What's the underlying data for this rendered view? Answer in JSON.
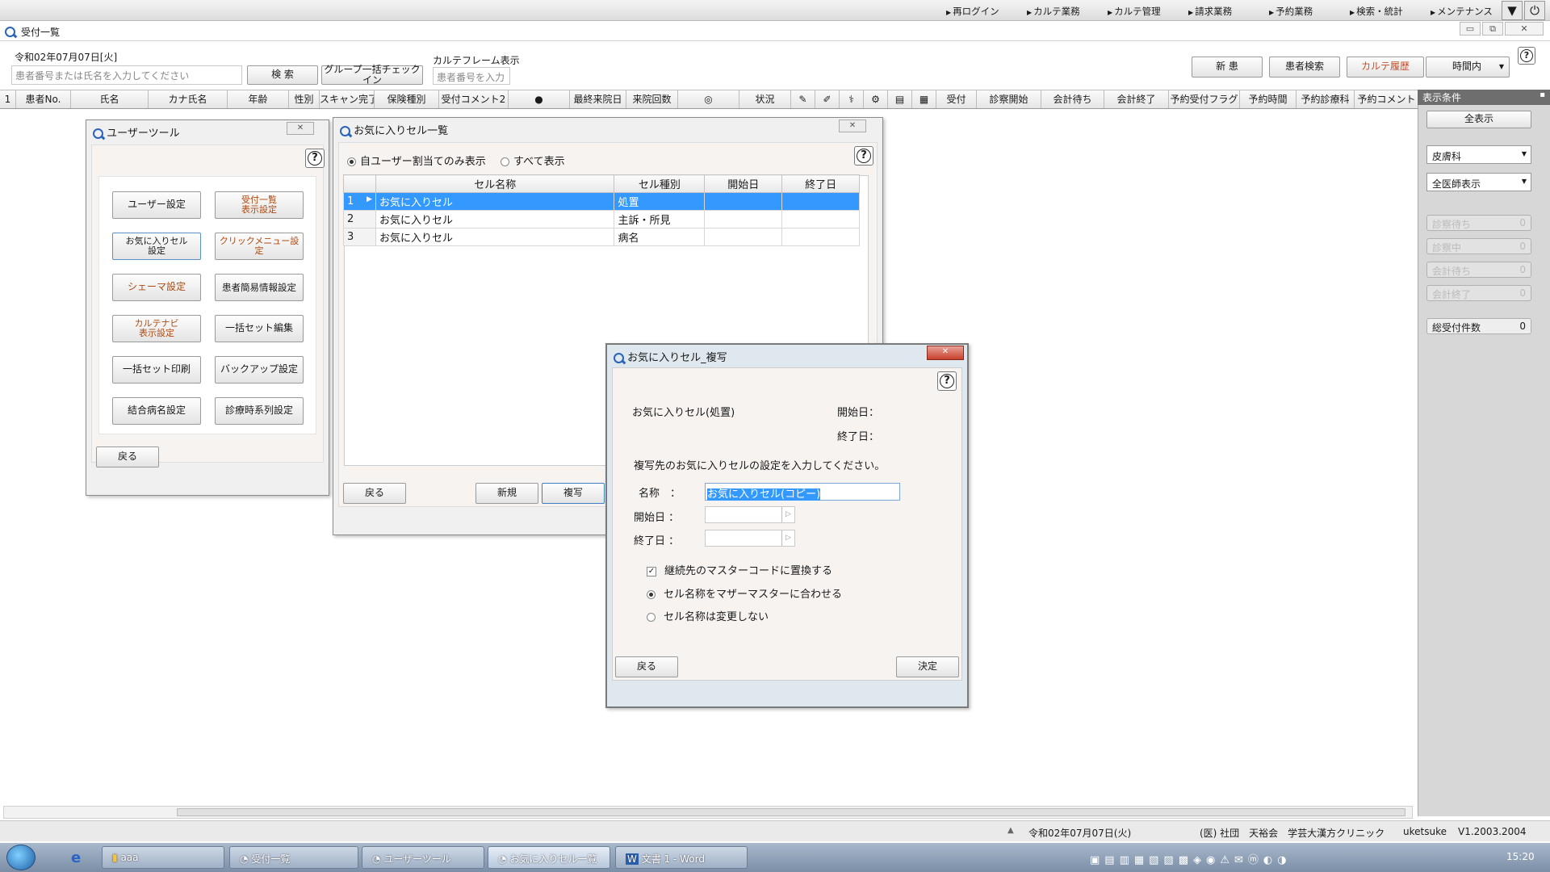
{
  "top_menu": {
    "items": [
      "再ログイン",
      "カルテ業務",
      "カルテ管理",
      "請求業務",
      "予約業務",
      "検索・統計",
      "メンテナンス"
    ]
  },
  "main_window": {
    "title": "受付一覧",
    "date_label": "令和02年07月07日[火]",
    "search_placeholder": "患者番号または氏名を入力してください",
    "search_button": "検 索",
    "group_checkin_button": "グループ一括チェックイン",
    "karte_frame_label": "カルテフレーム表示",
    "patient_number_placeholder": "患者番号を入力",
    "new_patient_button": "新 患",
    "patient_search_button": "患者検索",
    "karte_history_button": "カルテ履歴",
    "time_select": "時間内"
  },
  "columns": [
    "1",
    "患者No.",
    "氏名",
    "カナ氏名",
    "年齢",
    "性別",
    "スキャン完了",
    "保険種別",
    "受付コメント2",
    "",
    "最終来院日",
    "来院回数",
    "",
    "状況",
    "",
    "",
    "",
    "",
    "",
    "",
    "受付",
    "診察開始",
    "会計待ち",
    "会計終了",
    "予約受付フラグ",
    "予約時間",
    "予約診療科",
    "予約コメント"
  ],
  "right_panel": {
    "header": "表示条件",
    "all_button": "全表示",
    "dept_select": "皮膚科",
    "doctor_select": "全医師表示",
    "counters": [
      {
        "label": "診察待ち",
        "value": "0"
      },
      {
        "label": "診察中",
        "value": "0"
      },
      {
        "label": "会計待ち",
        "value": "0"
      },
      {
        "label": "会計終了",
        "value": "0"
      }
    ],
    "total": {
      "label": "総受付件数",
      "value": "0"
    }
  },
  "user_tool": {
    "title": "ユーザーツール",
    "buttons": [
      {
        "label": "ユーザー設定",
        "style": "normal"
      },
      {
        "label": "受付一覧\n表示設定",
        "style": "orange"
      },
      {
        "label": "お気に入りセル\n設定",
        "style": "normal"
      },
      {
        "label": "クリックメニュー設定",
        "style": "orange"
      },
      {
        "label": "シェーマ設定",
        "style": "orange"
      },
      {
        "label": "患者簡易情報設定",
        "style": "normal"
      },
      {
        "label": "カルテナビ\n表示設定",
        "style": "orange"
      },
      {
        "label": "一括セット編集",
        "style": "normal"
      },
      {
        "label": "一括セット印刷",
        "style": "normal"
      },
      {
        "label": "バックアップ設定",
        "style": "normal"
      },
      {
        "label": "結合病名設定",
        "style": "normal"
      },
      {
        "label": "診療時系列設定",
        "style": "normal"
      }
    ],
    "back_button": "戻る"
  },
  "favorites": {
    "title": "お気に入りセル一覧",
    "radio_own": "自ユーザー割当てのみ表示",
    "radio_all": "すべて表示",
    "headers": [
      "セル名称",
      "セル種別",
      "開始日",
      "終了日"
    ],
    "rows": [
      {
        "num": "1",
        "name": "お気に入りセル",
        "type": "処置",
        "start": "",
        "end": ""
      },
      {
        "num": "2",
        "name": "お気に入りセル",
        "type": "主訴・所見",
        "start": "",
        "end": ""
      },
      {
        "num": "3",
        "name": "お気に入りセル",
        "type": "病名",
        "start": "",
        "end": ""
      }
    ],
    "back_button": "戻る",
    "new_button": "新規",
    "copy_button": "複写"
  },
  "copy_dialog": {
    "title": "お気に入りセル_複写",
    "source_name": "お気に入りセル(処置)",
    "start_label": "開始日：",
    "end_label": "終了日：",
    "instruction": "複写先のお気に入りセルの設定を入力してください。",
    "name_label": "名称　：",
    "name_value": "お気に入りセル(コピー)",
    "start_field_label": "開始日 ：",
    "end_field_label": "終了日 ：",
    "check_replace": "継続先のマスターコードに置換する",
    "radio_match": "セル名称をマザーマスターに合わせる",
    "radio_keep": "セル名称は変更しない",
    "back_button": "戻る",
    "ok_button": "決定"
  },
  "status_bar": {
    "date": "令和02年07月07日(火)",
    "clinic": "(医) 社団　天裕会　学芸大漢方クリニック",
    "user": "uketsuke",
    "version": "V1.2003.2004"
  },
  "taskbar": {
    "tasks": [
      "aaa",
      "受付一覧",
      "ユーザーツール",
      "お気に入りセル一覧",
      "文書 1 - Word"
    ],
    "time": "15:20"
  }
}
